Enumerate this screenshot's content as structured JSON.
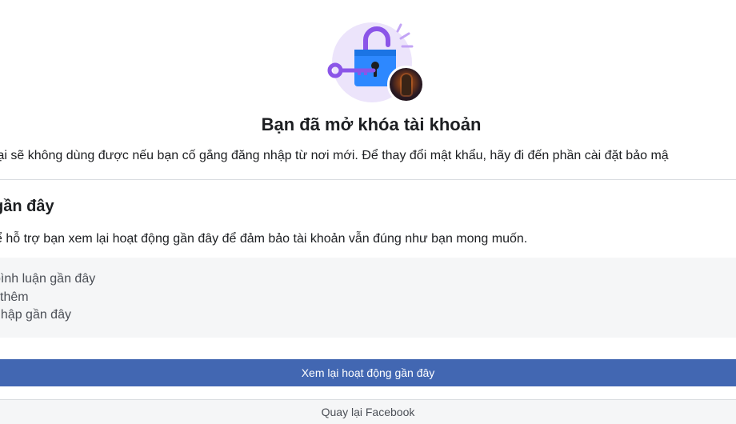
{
  "header": {
    "title": "Bạn đã mở khóa tài khoản",
    "subtitle": "tại sẽ không dùng được nếu bạn cố gắng đăng nhập từ nơi mới. Để thay đổi mật khẩu, hãy đi đến phần cài đặt bảo mậ",
    "illustration_icon": "unlocked-padlock-icon",
    "accent_color": "#4267b2"
  },
  "recent_activity": {
    "title": "gần đây",
    "description": "ể hỗ trợ bạn xem lại hoạt động gần đây để đảm bảo tài khoản vẫn đúng như bạn mong muốn.",
    "items": [
      "bình luận gần đây",
      "i thêm",
      "nhập gần đây"
    ]
  },
  "actions": {
    "review_label": "Xem lại hoạt động gần đây",
    "back_label": "Quay lại Facebook"
  }
}
